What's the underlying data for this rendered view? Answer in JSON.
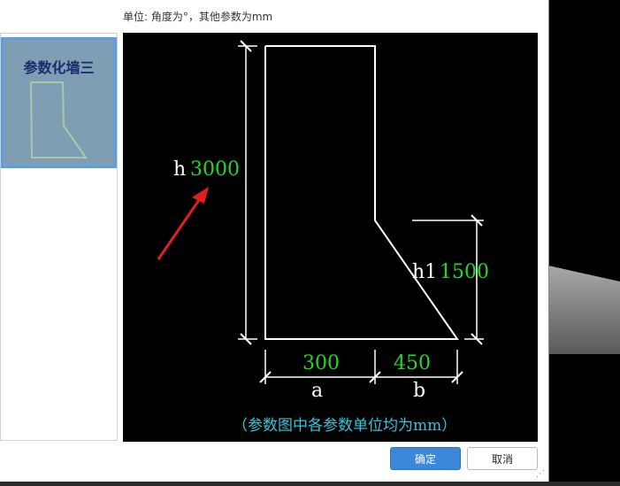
{
  "units_label": "单位:   角度为°，其他参数为mm",
  "thumbnail": {
    "title": "参数化墙三"
  },
  "diagram": {
    "h_label": "h",
    "h_value": "3000",
    "h1_label": "h1",
    "h1_value": "1500",
    "a_label": "a",
    "a_value": "300",
    "b_label": "b",
    "b_value": "450",
    "note": "（参数图中各参数单位均为mm）"
  },
  "buttons": {
    "ok": "确定",
    "cancel": "取消"
  },
  "colors": {
    "value_green": "#22d922",
    "label_white": "#ffffff",
    "note_cyan": "#2fc8e0",
    "arrow_red": "#e02020",
    "accent_blue": "#3d87db"
  },
  "icons": {
    "resize": "resize-grip-icon"
  }
}
